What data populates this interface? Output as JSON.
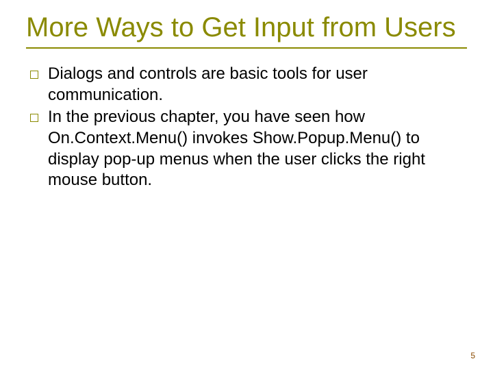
{
  "slide": {
    "title": "More Ways to Get Input from Users",
    "bullets": [
      "Dialogs and controls are basic tools for user communication.",
      "In the previous chapter, you have seen how On.Context.Menu() invokes Show.Popup.Menu() to display pop-up menus when the user clicks the right mouse button."
    ],
    "page_number": "5"
  }
}
